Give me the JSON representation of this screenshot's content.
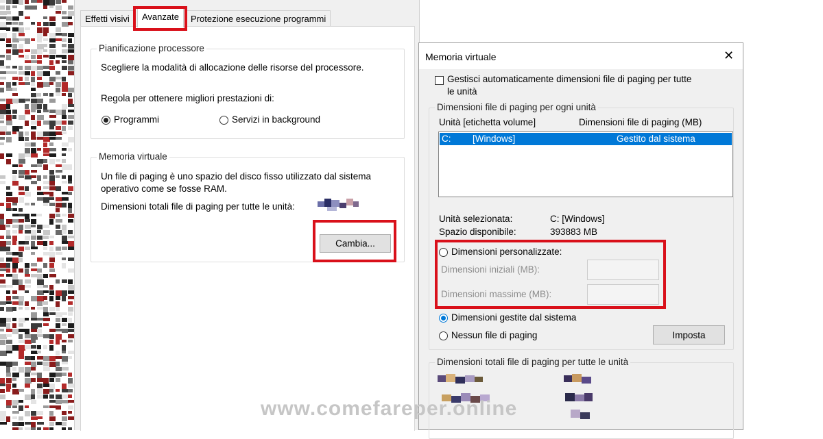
{
  "left_dialog": {
    "tabs": [
      {
        "label": "Effetti visivi"
      },
      {
        "label": "Avanzate"
      },
      {
        "label": "Protezione esecuzione programmi"
      }
    ],
    "processor": {
      "title": "Pianificazione processore",
      "description": "Scegliere la modalità di allocazione delle risorse del processore.",
      "adjust_label": "Regola per ottenere migliori prestazioni di:",
      "option_programs": "Programmi",
      "option_services": "Servizi in background"
    },
    "virtual_memory": {
      "title": "Memoria virtuale",
      "description_line1": "Un file di paging è uno spazio del disco fisso utilizzato dal sistema",
      "description_line2": "operativo come se fosse RAM.",
      "total_label": "Dimensioni totali file di paging per tutte le unità:",
      "change_button": "Cambia..."
    }
  },
  "right_dialog": {
    "title": "Memoria virtuale",
    "close_glyph": "✕",
    "auto_manage_line1": "Gestisci automaticamente dimensioni file di paging per tutte",
    "auto_manage_line2": "le unità",
    "per_drive_group": "Dimensioni file di paging per ogni unità",
    "col_drive": "Unità [etichetta volume]",
    "col_size": "Dimensioni file di paging (MB)",
    "row": {
      "drive": "C:",
      "label": "[Windows]",
      "size": "Gestito dal sistema"
    },
    "selected_drive_label": "Unità selezionata:",
    "selected_drive_value": "C:  [Windows]",
    "free_space_label": "Spazio disponibile:",
    "free_space_value": "393883 MB",
    "custom_size": "Dimensioni personalizzate:",
    "initial_size": "Dimensioni iniziali (MB):",
    "max_size": "Dimensioni massime (MB):",
    "system_managed": "Dimensioni gestite dal sistema",
    "no_paging": "Nessun file di paging",
    "set_button": "Imposta",
    "totals_group": "Dimensioni totali file di paging per tutte le unità"
  },
  "watermark": "www.comefareper.online",
  "colors": {
    "highlight": "#d9101a",
    "selection": "#0078d7"
  }
}
